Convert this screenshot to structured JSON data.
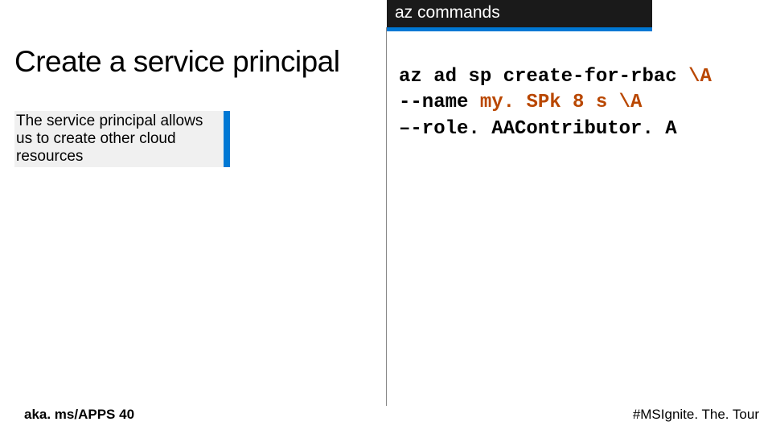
{
  "header": {
    "label": "az commands"
  },
  "main": {
    "heading": "Create a service principal",
    "callout": "The service principal allows us to create other cloud resources"
  },
  "code": {
    "line1a": "az ad sp create-for-rbac ",
    "line1b": "\\A",
    "line2a": "--name ",
    "line2b": "my. SPk 8 s ",
    "line2c": "\\A",
    "line3": "–-role. AAContributor. A"
  },
  "footer": {
    "left": "aka. ms/APPS 40",
    "right": "#MSIgnite. The. Tour"
  }
}
